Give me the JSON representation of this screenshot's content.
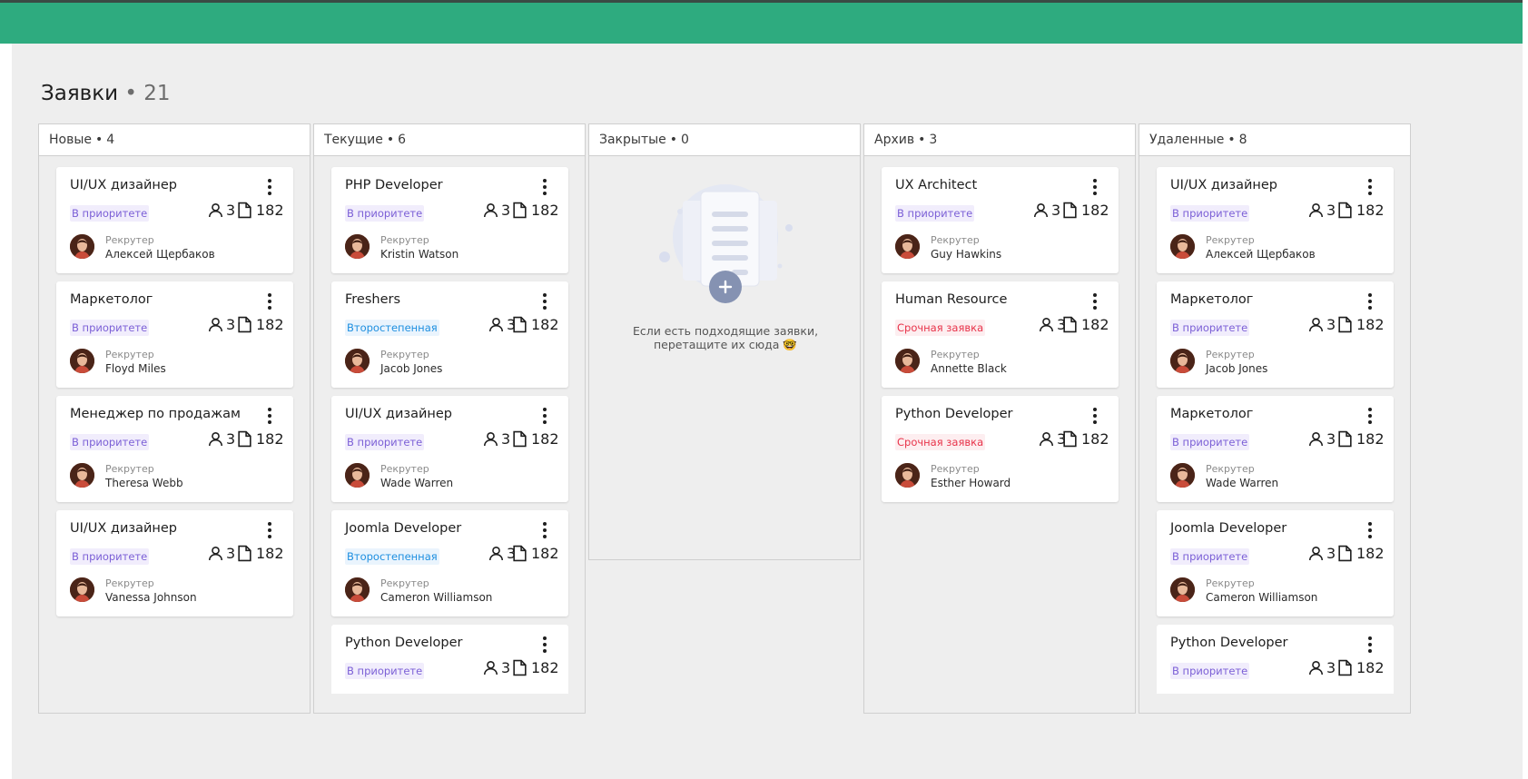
{
  "header": {
    "title": "Заявки",
    "dot": "•",
    "count": "21"
  },
  "colors": {
    "header_green": "#2eab7f",
    "tag_priority": "#7b5fd6",
    "tag_secondary": "#1e8fe0",
    "tag_urgent": "#e8334a"
  },
  "labels": {
    "recruiter": "Рекрутер",
    "dot": "•"
  },
  "tag_styles": {
    "priority": {
      "text": "#7b5fd6",
      "bg": "#f1edfc"
    },
    "secondary": {
      "text": "#1e8fe0",
      "bg": "#eaf4fd"
    },
    "urgent": {
      "text": "#e8334a",
      "bg": "#fdeef0"
    }
  },
  "icons": {
    "people": "person-icon",
    "files": "document-icon",
    "menu": "more-vertical-icon",
    "avatar": "user-avatar",
    "add": "plus-icon"
  },
  "columns": [
    {
      "name": "Новые",
      "count": "4",
      "cards": [
        {
          "title": "UI/UX дизайнер",
          "tag": "В приоритете",
          "tag_type": "priority",
          "people": "3",
          "files": "182",
          "recruiter": "Алексей Щербаков"
        },
        {
          "title": "Маркетолог",
          "tag": "В приоритете",
          "tag_type": "priority",
          "people": "3",
          "files": "182",
          "recruiter": "Floyd Miles"
        },
        {
          "title": "Менеджер по продажам",
          "tag": "В приоритете",
          "tag_type": "priority",
          "people": "3",
          "files": "182",
          "recruiter": "Theresa Webb"
        },
        {
          "title": "UI/UX дизайнер",
          "tag": "В приоритете",
          "tag_type": "priority",
          "people": "3",
          "files": "182",
          "recruiter": "Vanessa Johnson"
        }
      ]
    },
    {
      "name": "Текущие",
      "count": "6",
      "cards": [
        {
          "title": "PHP Developer",
          "tag": "В приоритете",
          "tag_type": "priority",
          "people": "3",
          "files": "182",
          "recruiter": "Kristin Watson"
        },
        {
          "title": "Freshers",
          "tag": "Второстепенная",
          "tag_type": "secondary",
          "people": "3",
          "files": "182",
          "recruiter": "Jacob Jones"
        },
        {
          "title": "UI/UX дизайнер",
          "tag": "В приоритете",
          "tag_type": "priority",
          "people": "3",
          "files": "182",
          "recruiter": "Wade Warren"
        },
        {
          "title": "Joomla Developer",
          "tag": "Второстепенная",
          "tag_type": "secondary",
          "people": "3",
          "files": "182",
          "recruiter": "Cameron Williamson"
        },
        {
          "title": "Python Developer",
          "tag": "В приоритете",
          "tag_type": "priority",
          "people": "3",
          "files": "182",
          "recruiter": "",
          "partial": true
        }
      ]
    },
    {
      "name": "Закрытые",
      "count": "0",
      "cards": [],
      "empty_text_line1": "Если есть подходящие заявки,",
      "empty_text_line2": "перетащите их сюда 🤓"
    },
    {
      "name": "Архив",
      "count": "3",
      "cards": [
        {
          "title": "UX Architect",
          "tag": "В приоритете",
          "tag_type": "priority",
          "people": "3",
          "files": "182",
          "recruiter": "Guy Hawkins"
        },
        {
          "title": "Human Resource",
          "tag": "Срочная заявка",
          "tag_type": "urgent",
          "people": "3",
          "files": "182",
          "recruiter": "Annette Black"
        },
        {
          "title": "Python Developer",
          "tag": "Срочная заявка",
          "tag_type": "urgent",
          "people": "3",
          "files": "182",
          "recruiter": "Esther Howard"
        }
      ]
    },
    {
      "name": "Удаленные",
      "count": "8",
      "cards": [
        {
          "title": "UI/UX дизайнер",
          "tag": "В приоритете",
          "tag_type": "priority",
          "people": "3",
          "files": "182",
          "recruiter": "Алексей Щербаков"
        },
        {
          "title": "Маркетолог",
          "tag": "В приоритете",
          "tag_type": "priority",
          "people": "3",
          "files": "182",
          "recruiter": "Jacob Jones"
        },
        {
          "title": "Маркетолог",
          "tag": "В приоритете",
          "tag_type": "priority",
          "people": "3",
          "files": "182",
          "recruiter": "Wade Warren"
        },
        {
          "title": "Joomla Developer",
          "tag": "В приоритете",
          "tag_type": "priority",
          "people": "3",
          "files": "182",
          "recruiter": "Cameron Williamson"
        },
        {
          "title": "Python Developer",
          "tag": "В приоритете",
          "tag_type": "priority",
          "people": "3",
          "files": "182",
          "recruiter": "",
          "partial": true
        }
      ]
    }
  ]
}
